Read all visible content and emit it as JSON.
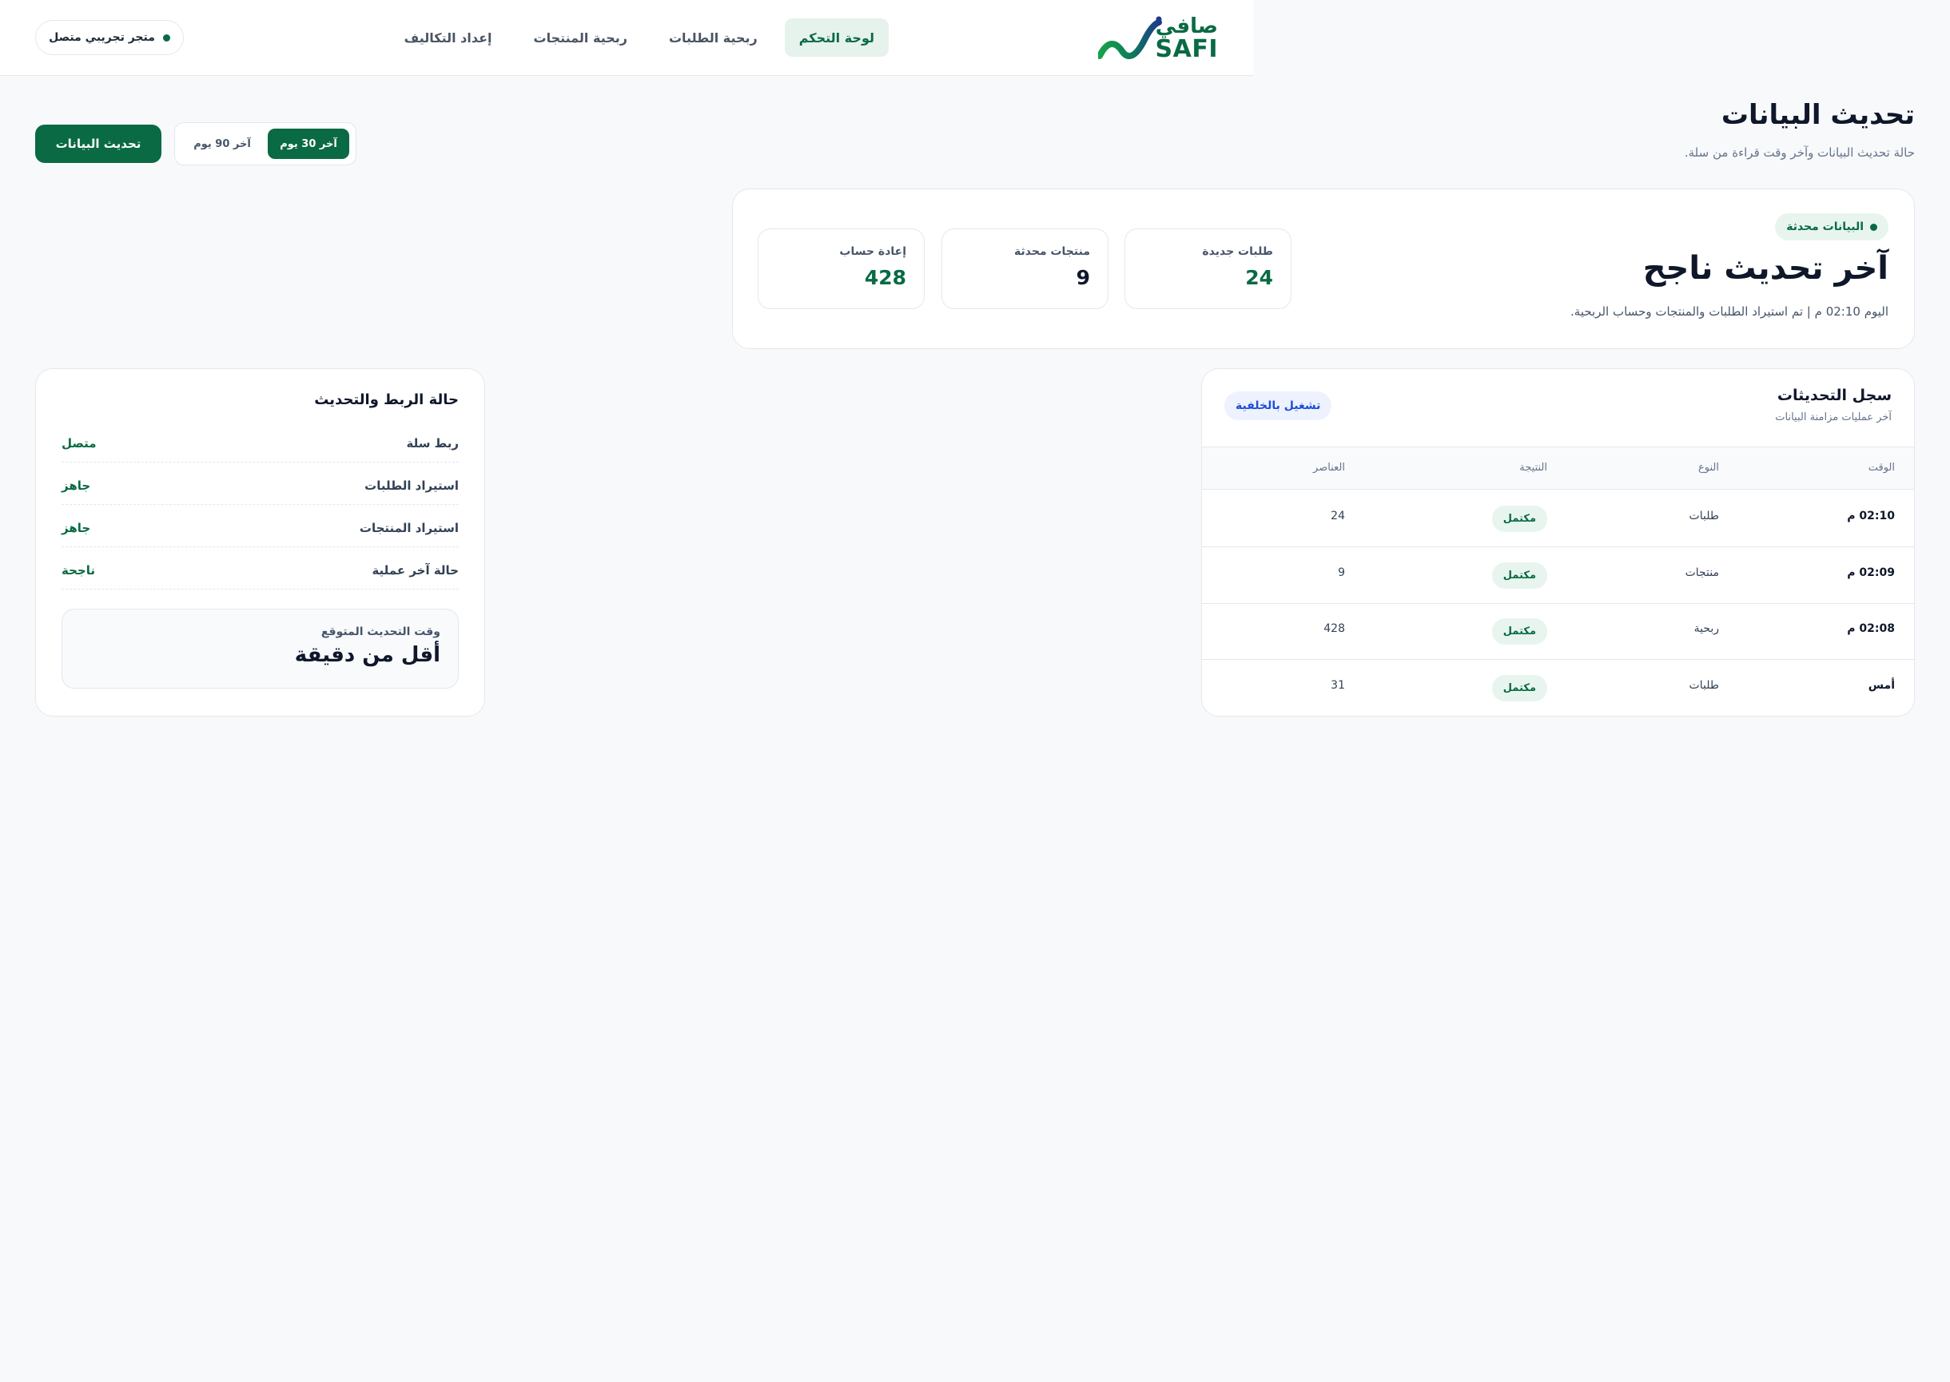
{
  "brand": {
    "name_ar": "صافي",
    "name_en": "SAFI",
    "color": "#0a6a44"
  },
  "nav": {
    "items": [
      {
        "label": "لوحة التحكم",
        "active": true
      },
      {
        "label": "ربحية الطلبات",
        "active": false
      },
      {
        "label": "ربحية المنتجات",
        "active": false
      },
      {
        "label": "إعداد التكاليف",
        "active": false
      }
    ]
  },
  "store": {
    "label": "متجر تجريبي متصل"
  },
  "page": {
    "title": "تحديث البيانات",
    "subtitle": "حالة تحديث البيانات وآخر وقت قراءة من سلة.",
    "refresh_label": "تحديث البيانات",
    "range": {
      "options": [
        "آخر 30 يوم",
        "آخر 90 يوم"
      ],
      "selected": "آخر 30 يوم"
    }
  },
  "summary": {
    "status_label": "البيانات محدثة",
    "title": "آخر تحديث ناجح",
    "description": "اليوم 02:10 م | تم استيراد الطلبات والمنتجات وحساب الربحية.",
    "stats": [
      {
        "label": "طلبات جديدة",
        "value": "24"
      },
      {
        "label": "منتجات محدثة",
        "value": "9"
      },
      {
        "label": "إعادة حساب",
        "value": "428"
      }
    ]
  },
  "log": {
    "title": "سجل التحديثات",
    "subtitle": "آخر عمليات مزامنة البيانات",
    "badge": "تشغيل بالخلفية",
    "columns": [
      "الوقت",
      "النوع",
      "النتيجة",
      "العناصر"
    ],
    "rows": [
      {
        "time": "02:10 م",
        "type": "طلبات",
        "result": "مكتمل",
        "items": "24"
      },
      {
        "time": "02:09 م",
        "type": "منتجات",
        "result": "مكتمل",
        "items": "9"
      },
      {
        "time": "02:08 م",
        "type": "ربحية",
        "result": "مكتمل",
        "items": "428"
      },
      {
        "time": "أمس",
        "type": "طلبات",
        "result": "مكتمل",
        "items": "31"
      }
    ]
  },
  "connection": {
    "title": "حالة الربط والتحديث",
    "rows": [
      {
        "key": "ربط سلة",
        "value": "متصل"
      },
      {
        "key": "استيراد الطلبات",
        "value": "جاهز"
      },
      {
        "key": "استيراد المنتجات",
        "value": "جاهز"
      },
      {
        "key": "حالة آخر عملية",
        "value": "ناجحة"
      }
    ],
    "eta_label": "وقت التحديث المتوقع",
    "eta_value": "أقل من دقيقة"
  }
}
